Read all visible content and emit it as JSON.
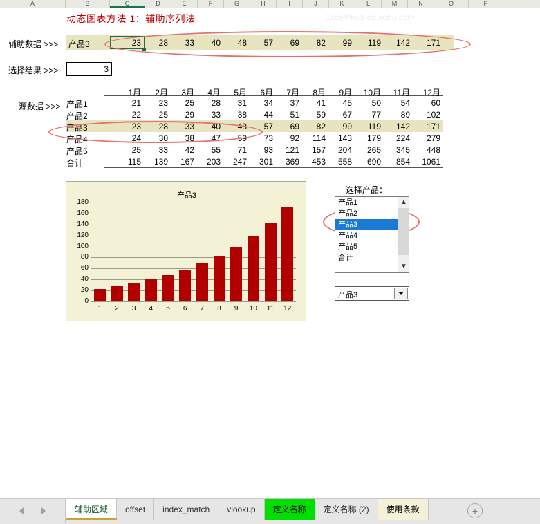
{
  "columns": [
    "A",
    "B",
    "C",
    "D",
    "E",
    "F",
    "G",
    "H",
    "I",
    "J",
    "K",
    "L",
    "M",
    "N",
    "O",
    "P"
  ],
  "active_column": "C",
  "title": "动态图表方法 1：辅助序列法",
  "watermark": "ExcelPro.blog.sohu.com",
  "helper": {
    "label": "辅助数据 >>>",
    "product": "产品3",
    "values": [
      23,
      28,
      33,
      40,
      48,
      57,
      69,
      82,
      99,
      119,
      142,
      171
    ],
    "selected_value": 23
  },
  "result": {
    "label": "选择结果 >>>",
    "value": 3
  },
  "source": {
    "label": "源数据 >>>",
    "months": [
      "1月",
      "2月",
      "3月",
      "4月",
      "5月",
      "6月",
      "7月",
      "8月",
      "9月",
      "10月",
      "11月",
      "12月"
    ],
    "rows": [
      {
        "name": "产品1",
        "values": [
          21,
          23,
          25,
          28,
          31,
          34,
          37,
          41,
          45,
          50,
          54,
          60
        ],
        "highlight": false
      },
      {
        "name": "产品2",
        "values": [
          22,
          25,
          29,
          33,
          38,
          44,
          51,
          59,
          67,
          77,
          89,
          102
        ],
        "highlight": false
      },
      {
        "name": "产品3",
        "values": [
          23,
          28,
          33,
          40,
          48,
          57,
          69,
          82,
          99,
          119,
          142,
          171
        ],
        "highlight": true
      },
      {
        "name": "产品4",
        "values": [
          24,
          30,
          38,
          47,
          59,
          73,
          92,
          114,
          143,
          179,
          224,
          279
        ],
        "highlight": false
      },
      {
        "name": "产品5",
        "values": [
          25,
          33,
          42,
          55,
          71,
          93,
          121,
          157,
          204,
          265,
          345,
          448
        ],
        "highlight": false
      },
      {
        "name": "合计",
        "values": [
          115,
          139,
          167,
          203,
          247,
          301,
          369,
          453,
          558,
          690,
          854,
          1061
        ],
        "highlight": false
      }
    ]
  },
  "chart_data": {
    "type": "bar",
    "title": "产品3",
    "categories": [
      "1",
      "2",
      "3",
      "4",
      "5",
      "6",
      "7",
      "8",
      "9",
      "10",
      "11",
      "12"
    ],
    "values": [
      23,
      28,
      33,
      40,
      48,
      57,
      69,
      82,
      99,
      119,
      142,
      171
    ],
    "xlabel": "",
    "ylabel": "",
    "ylim": [
      0,
      180
    ],
    "yticks": [
      0,
      20,
      40,
      60,
      80,
      100,
      120,
      140,
      160,
      180
    ],
    "grid": true,
    "legend": false,
    "bar_color": "#b20000",
    "plot_background": "#f3f1d6"
  },
  "listbox": {
    "label": "选择产品：",
    "items": [
      "产品1",
      "产品2",
      "产品3",
      "产品4",
      "产品5",
      "合计"
    ],
    "selected_index": 2,
    "scroll_up_icon": "▲",
    "scroll_down_icon": "▼"
  },
  "combo": {
    "value": "产品3"
  },
  "tabs": [
    {
      "label": "辅助区域",
      "state": "active"
    },
    {
      "label": "offset",
      "state": "normal"
    },
    {
      "label": "index_match",
      "state": "normal"
    },
    {
      "label": "vlookup",
      "state": "normal"
    },
    {
      "label": "定义名称",
      "state": "green"
    },
    {
      "label": "定义名称 (2)",
      "state": "normal"
    },
    {
      "label": "使用条款",
      "state": "cream"
    }
  ],
  "add_sheet_label": "+"
}
